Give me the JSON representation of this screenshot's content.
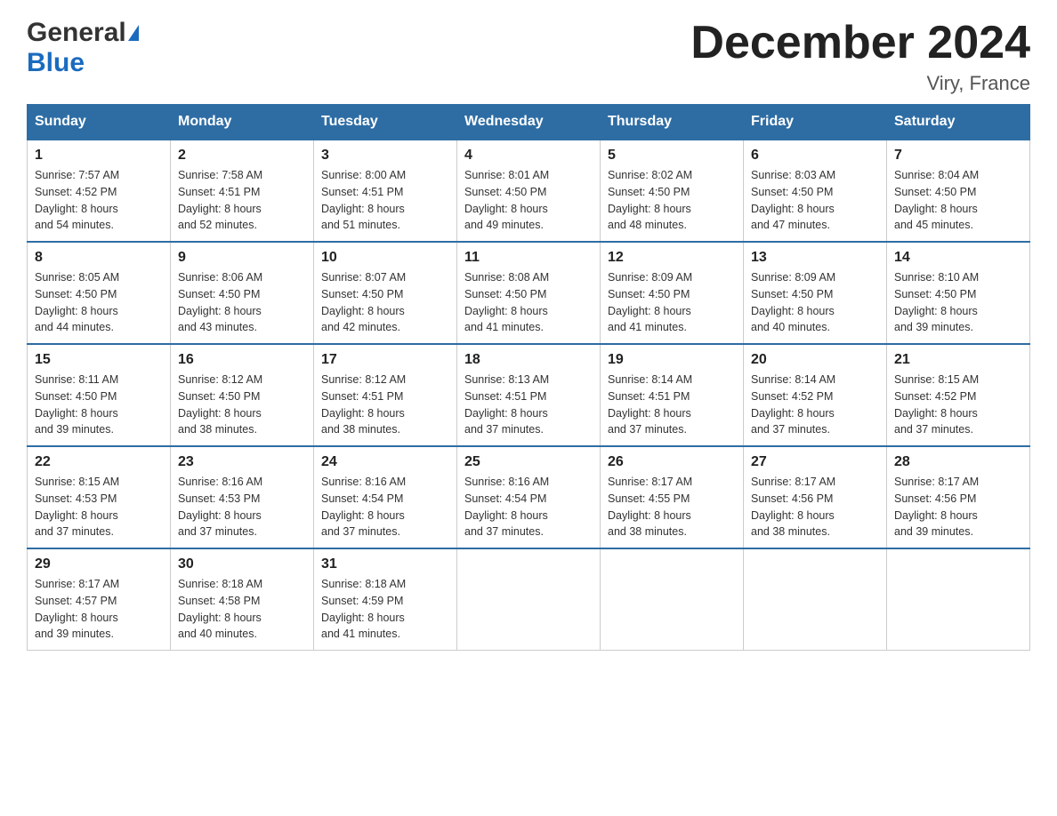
{
  "logo": {
    "general": "General",
    "blue": "Blue"
  },
  "title": "December 2024",
  "location": "Viry, France",
  "days_of_week": [
    "Sunday",
    "Monday",
    "Tuesday",
    "Wednesday",
    "Thursday",
    "Friday",
    "Saturday"
  ],
  "weeks": [
    [
      {
        "day": "1",
        "sunrise": "7:57 AM",
        "sunset": "4:52 PM",
        "daylight": "8 hours and 54 minutes."
      },
      {
        "day": "2",
        "sunrise": "7:58 AM",
        "sunset": "4:51 PM",
        "daylight": "8 hours and 52 minutes."
      },
      {
        "day": "3",
        "sunrise": "8:00 AM",
        "sunset": "4:51 PM",
        "daylight": "8 hours and 51 minutes."
      },
      {
        "day": "4",
        "sunrise": "8:01 AM",
        "sunset": "4:50 PM",
        "daylight": "8 hours and 49 minutes."
      },
      {
        "day": "5",
        "sunrise": "8:02 AM",
        "sunset": "4:50 PM",
        "daylight": "8 hours and 48 minutes."
      },
      {
        "day": "6",
        "sunrise": "8:03 AM",
        "sunset": "4:50 PM",
        "daylight": "8 hours and 47 minutes."
      },
      {
        "day": "7",
        "sunrise": "8:04 AM",
        "sunset": "4:50 PM",
        "daylight": "8 hours and 45 minutes."
      }
    ],
    [
      {
        "day": "8",
        "sunrise": "8:05 AM",
        "sunset": "4:50 PM",
        "daylight": "8 hours and 44 minutes."
      },
      {
        "day": "9",
        "sunrise": "8:06 AM",
        "sunset": "4:50 PM",
        "daylight": "8 hours and 43 minutes."
      },
      {
        "day": "10",
        "sunrise": "8:07 AM",
        "sunset": "4:50 PM",
        "daylight": "8 hours and 42 minutes."
      },
      {
        "day": "11",
        "sunrise": "8:08 AM",
        "sunset": "4:50 PM",
        "daylight": "8 hours and 41 minutes."
      },
      {
        "day": "12",
        "sunrise": "8:09 AM",
        "sunset": "4:50 PM",
        "daylight": "8 hours and 41 minutes."
      },
      {
        "day": "13",
        "sunrise": "8:09 AM",
        "sunset": "4:50 PM",
        "daylight": "8 hours and 40 minutes."
      },
      {
        "day": "14",
        "sunrise": "8:10 AM",
        "sunset": "4:50 PM",
        "daylight": "8 hours and 39 minutes."
      }
    ],
    [
      {
        "day": "15",
        "sunrise": "8:11 AM",
        "sunset": "4:50 PM",
        "daylight": "8 hours and 39 minutes."
      },
      {
        "day": "16",
        "sunrise": "8:12 AM",
        "sunset": "4:50 PM",
        "daylight": "8 hours and 38 minutes."
      },
      {
        "day": "17",
        "sunrise": "8:12 AM",
        "sunset": "4:51 PM",
        "daylight": "8 hours and 38 minutes."
      },
      {
        "day": "18",
        "sunrise": "8:13 AM",
        "sunset": "4:51 PM",
        "daylight": "8 hours and 37 minutes."
      },
      {
        "day": "19",
        "sunrise": "8:14 AM",
        "sunset": "4:51 PM",
        "daylight": "8 hours and 37 minutes."
      },
      {
        "day": "20",
        "sunrise": "8:14 AM",
        "sunset": "4:52 PM",
        "daylight": "8 hours and 37 minutes."
      },
      {
        "day": "21",
        "sunrise": "8:15 AM",
        "sunset": "4:52 PM",
        "daylight": "8 hours and 37 minutes."
      }
    ],
    [
      {
        "day": "22",
        "sunrise": "8:15 AM",
        "sunset": "4:53 PM",
        "daylight": "8 hours and 37 minutes."
      },
      {
        "day": "23",
        "sunrise": "8:16 AM",
        "sunset": "4:53 PM",
        "daylight": "8 hours and 37 minutes."
      },
      {
        "day": "24",
        "sunrise": "8:16 AM",
        "sunset": "4:54 PM",
        "daylight": "8 hours and 37 minutes."
      },
      {
        "day": "25",
        "sunrise": "8:16 AM",
        "sunset": "4:54 PM",
        "daylight": "8 hours and 37 minutes."
      },
      {
        "day": "26",
        "sunrise": "8:17 AM",
        "sunset": "4:55 PM",
        "daylight": "8 hours and 38 minutes."
      },
      {
        "day": "27",
        "sunrise": "8:17 AM",
        "sunset": "4:56 PM",
        "daylight": "8 hours and 38 minutes."
      },
      {
        "day": "28",
        "sunrise": "8:17 AM",
        "sunset": "4:56 PM",
        "daylight": "8 hours and 39 minutes."
      }
    ],
    [
      {
        "day": "29",
        "sunrise": "8:17 AM",
        "sunset": "4:57 PM",
        "daylight": "8 hours and 39 minutes."
      },
      {
        "day": "30",
        "sunrise": "8:18 AM",
        "sunset": "4:58 PM",
        "daylight": "8 hours and 40 minutes."
      },
      {
        "day": "31",
        "sunrise": "8:18 AM",
        "sunset": "4:59 PM",
        "daylight": "8 hours and 41 minutes."
      },
      null,
      null,
      null,
      null
    ]
  ],
  "labels": {
    "sunrise": "Sunrise:",
    "sunset": "Sunset:",
    "daylight": "Daylight:"
  }
}
